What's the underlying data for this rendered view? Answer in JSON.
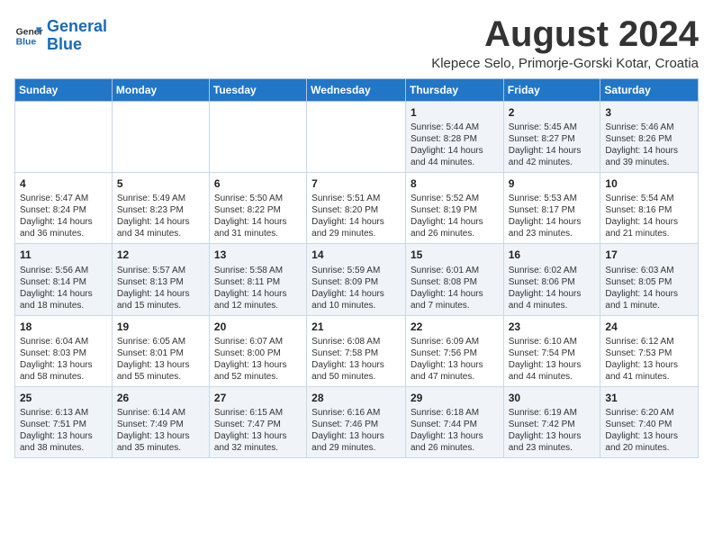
{
  "logo": {
    "line1": "General",
    "line2": "Blue"
  },
  "title": "August 2024",
  "subtitle": "Klepece Selo, Primorje-Gorski Kotar, Croatia",
  "weekdays": [
    "Sunday",
    "Monday",
    "Tuesday",
    "Wednesday",
    "Thursday",
    "Friday",
    "Saturday"
  ],
  "weeks": [
    [
      {
        "day": "",
        "content": ""
      },
      {
        "day": "",
        "content": ""
      },
      {
        "day": "",
        "content": ""
      },
      {
        "day": "",
        "content": ""
      },
      {
        "day": "1",
        "content": "Sunrise: 5:44 AM\nSunset: 8:28 PM\nDaylight: 14 hours\nand 44 minutes."
      },
      {
        "day": "2",
        "content": "Sunrise: 5:45 AM\nSunset: 8:27 PM\nDaylight: 14 hours\nand 42 minutes."
      },
      {
        "day": "3",
        "content": "Sunrise: 5:46 AM\nSunset: 8:26 PM\nDaylight: 14 hours\nand 39 minutes."
      }
    ],
    [
      {
        "day": "4",
        "content": "Sunrise: 5:47 AM\nSunset: 8:24 PM\nDaylight: 14 hours\nand 36 minutes."
      },
      {
        "day": "5",
        "content": "Sunrise: 5:49 AM\nSunset: 8:23 PM\nDaylight: 14 hours\nand 34 minutes."
      },
      {
        "day": "6",
        "content": "Sunrise: 5:50 AM\nSunset: 8:22 PM\nDaylight: 14 hours\nand 31 minutes."
      },
      {
        "day": "7",
        "content": "Sunrise: 5:51 AM\nSunset: 8:20 PM\nDaylight: 14 hours\nand 29 minutes."
      },
      {
        "day": "8",
        "content": "Sunrise: 5:52 AM\nSunset: 8:19 PM\nDaylight: 14 hours\nand 26 minutes."
      },
      {
        "day": "9",
        "content": "Sunrise: 5:53 AM\nSunset: 8:17 PM\nDaylight: 14 hours\nand 23 minutes."
      },
      {
        "day": "10",
        "content": "Sunrise: 5:54 AM\nSunset: 8:16 PM\nDaylight: 14 hours\nand 21 minutes."
      }
    ],
    [
      {
        "day": "11",
        "content": "Sunrise: 5:56 AM\nSunset: 8:14 PM\nDaylight: 14 hours\nand 18 minutes."
      },
      {
        "day": "12",
        "content": "Sunrise: 5:57 AM\nSunset: 8:13 PM\nDaylight: 14 hours\nand 15 minutes."
      },
      {
        "day": "13",
        "content": "Sunrise: 5:58 AM\nSunset: 8:11 PM\nDaylight: 14 hours\nand 12 minutes."
      },
      {
        "day": "14",
        "content": "Sunrise: 5:59 AM\nSunset: 8:09 PM\nDaylight: 14 hours\nand 10 minutes."
      },
      {
        "day": "15",
        "content": "Sunrise: 6:01 AM\nSunset: 8:08 PM\nDaylight: 14 hours\nand 7 minutes."
      },
      {
        "day": "16",
        "content": "Sunrise: 6:02 AM\nSunset: 8:06 PM\nDaylight: 14 hours\nand 4 minutes."
      },
      {
        "day": "17",
        "content": "Sunrise: 6:03 AM\nSunset: 8:05 PM\nDaylight: 14 hours\nand 1 minute."
      }
    ],
    [
      {
        "day": "18",
        "content": "Sunrise: 6:04 AM\nSunset: 8:03 PM\nDaylight: 13 hours\nand 58 minutes."
      },
      {
        "day": "19",
        "content": "Sunrise: 6:05 AM\nSunset: 8:01 PM\nDaylight: 13 hours\nand 55 minutes."
      },
      {
        "day": "20",
        "content": "Sunrise: 6:07 AM\nSunset: 8:00 PM\nDaylight: 13 hours\nand 52 minutes."
      },
      {
        "day": "21",
        "content": "Sunrise: 6:08 AM\nSunset: 7:58 PM\nDaylight: 13 hours\nand 50 minutes."
      },
      {
        "day": "22",
        "content": "Sunrise: 6:09 AM\nSunset: 7:56 PM\nDaylight: 13 hours\nand 47 minutes."
      },
      {
        "day": "23",
        "content": "Sunrise: 6:10 AM\nSunset: 7:54 PM\nDaylight: 13 hours\nand 44 minutes."
      },
      {
        "day": "24",
        "content": "Sunrise: 6:12 AM\nSunset: 7:53 PM\nDaylight: 13 hours\nand 41 minutes."
      }
    ],
    [
      {
        "day": "25",
        "content": "Sunrise: 6:13 AM\nSunset: 7:51 PM\nDaylight: 13 hours\nand 38 minutes."
      },
      {
        "day": "26",
        "content": "Sunrise: 6:14 AM\nSunset: 7:49 PM\nDaylight: 13 hours\nand 35 minutes."
      },
      {
        "day": "27",
        "content": "Sunrise: 6:15 AM\nSunset: 7:47 PM\nDaylight: 13 hours\nand 32 minutes."
      },
      {
        "day": "28",
        "content": "Sunrise: 6:16 AM\nSunset: 7:46 PM\nDaylight: 13 hours\nand 29 minutes."
      },
      {
        "day": "29",
        "content": "Sunrise: 6:18 AM\nSunset: 7:44 PM\nDaylight: 13 hours\nand 26 minutes."
      },
      {
        "day": "30",
        "content": "Sunrise: 6:19 AM\nSunset: 7:42 PM\nDaylight: 13 hours\nand 23 minutes."
      },
      {
        "day": "31",
        "content": "Sunrise: 6:20 AM\nSunset: 7:40 PM\nDaylight: 13 hours\nand 20 minutes."
      }
    ]
  ]
}
